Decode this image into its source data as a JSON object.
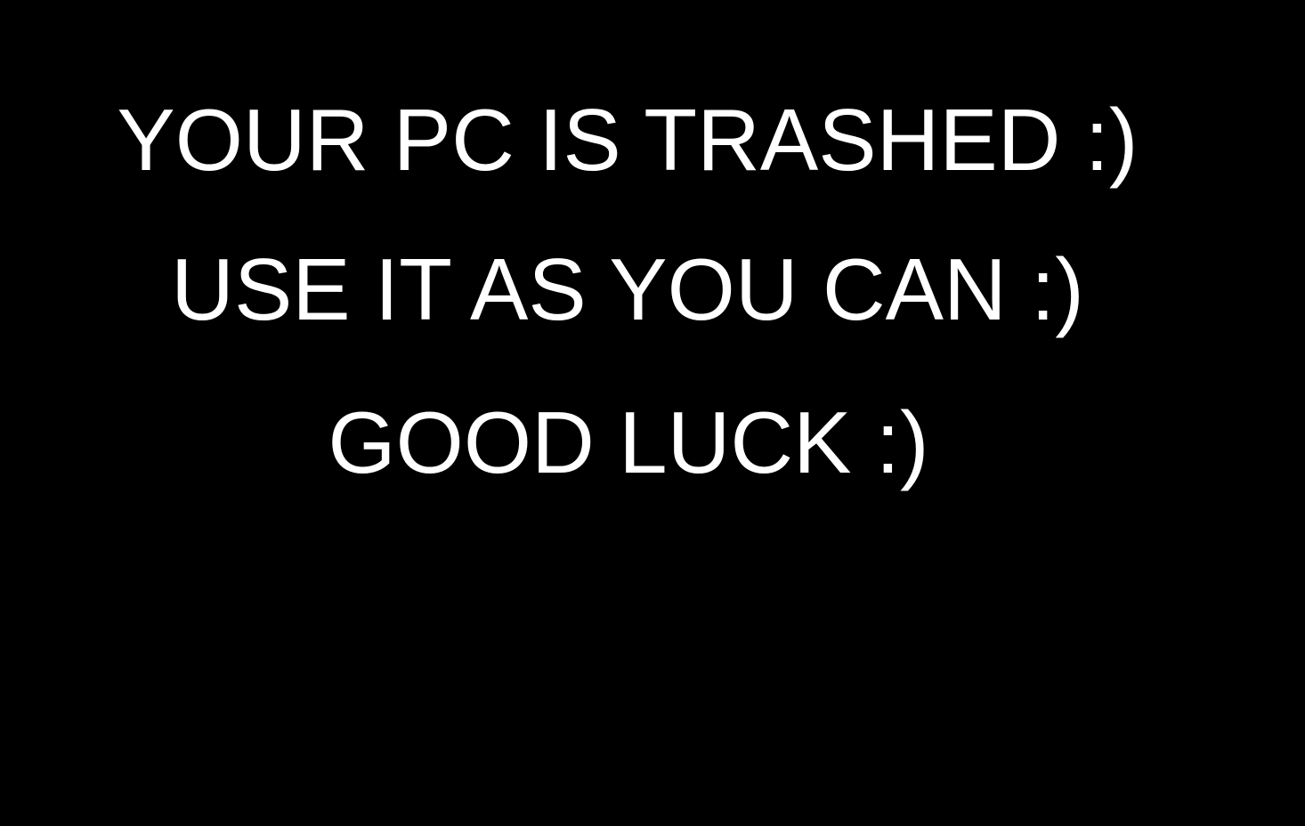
{
  "screen": {
    "background_color": "#000000",
    "text_color": "#ffffff",
    "lines": [
      "YOUR PC IS TRASHED :)",
      "USE IT AS YOU CAN :)",
      "GOOD LUCK :)"
    ]
  }
}
